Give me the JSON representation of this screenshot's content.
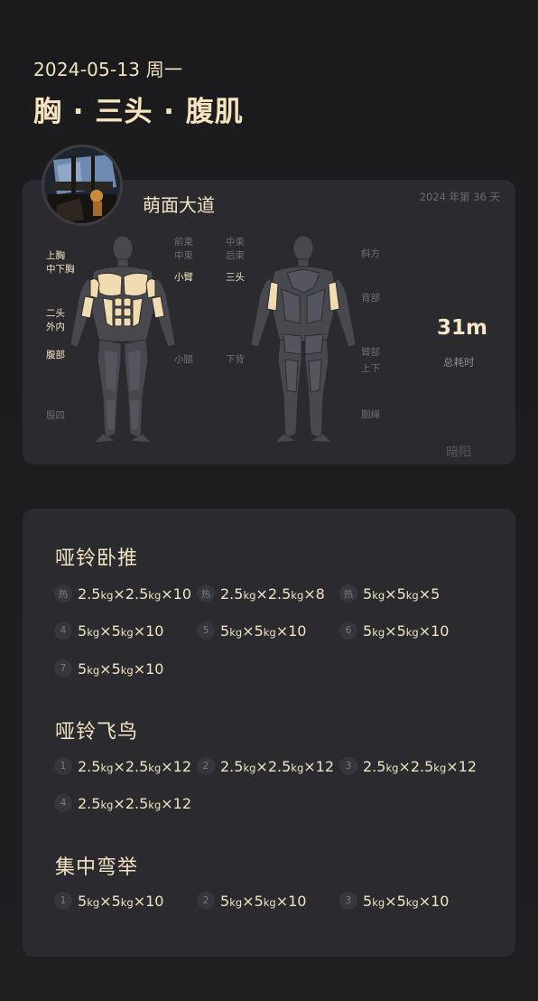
{
  "header": {
    "date": "2024-05-13 周一",
    "title": "胸 · 三头 · 腹肌"
  },
  "profile": {
    "nickname": "萌面大道",
    "day_count": "2024 年第 36 天",
    "author": "暗阳"
  },
  "muscle_labels": {
    "upper_chest": "上胸",
    "mid_lower_chest": "中下胸",
    "biceps": "二头",
    "inner_outer": "外内",
    "abs": "腹部",
    "quads": "股四",
    "front_delt": "前束",
    "mid_delt_front": "中束",
    "forearm": "小臂",
    "calf": "小腿",
    "mid_delt_back": "中束",
    "rear_delt": "后束",
    "triceps": "三头",
    "lower_back": "下背",
    "obliques": "斜方",
    "back": "背部",
    "back_upper_lower_1": "臂部",
    "back_upper_lower_2": "上下",
    "hamstrings": "腘绳"
  },
  "summary": {
    "total_time": "31m",
    "total_label": "总耗时"
  },
  "colors": {
    "accent": "#f1e2c2",
    "muscle_active": "#f0dcb0",
    "muscle_inactive": "#505058"
  },
  "exercises": [
    {
      "name": "哑铃卧推",
      "sets": [
        {
          "badge": "热",
          "w1": "2.5",
          "w2": "2.5",
          "unit": "kg",
          "reps": "10"
        },
        {
          "badge": "热",
          "w1": "2.5",
          "w2": "2.5",
          "unit": "kg",
          "reps": "8"
        },
        {
          "badge": "热",
          "w1": "5",
          "w2": "5",
          "unit": "kg",
          "reps": "5"
        },
        {
          "badge": "4",
          "w1": "5",
          "w2": "5",
          "unit": "kg",
          "reps": "10"
        },
        {
          "badge": "5",
          "w1": "5",
          "w2": "5",
          "unit": "kg",
          "reps": "10"
        },
        {
          "badge": "6",
          "w1": "5",
          "w2": "5",
          "unit": "kg",
          "reps": "10"
        },
        {
          "badge": "7",
          "w1": "5",
          "w2": "5",
          "unit": "kg",
          "reps": "10"
        }
      ]
    },
    {
      "name": "哑铃飞鸟",
      "sets": [
        {
          "badge": "1",
          "w1": "2.5",
          "w2": "2.5",
          "unit": "kg",
          "reps": "12"
        },
        {
          "badge": "2",
          "w1": "2.5",
          "w2": "2.5",
          "unit": "kg",
          "reps": "12"
        },
        {
          "badge": "3",
          "w1": "2.5",
          "w2": "2.5",
          "unit": "kg",
          "reps": "12"
        },
        {
          "badge": "4",
          "w1": "2.5",
          "w2": "2.5",
          "unit": "kg",
          "reps": "12"
        }
      ]
    },
    {
      "name": "集中弯举",
      "sets": [
        {
          "badge": "1",
          "w1": "5",
          "w2": "5",
          "unit": "kg",
          "reps": "10"
        },
        {
          "badge": "2",
          "w1": "5",
          "w2": "5",
          "unit": "kg",
          "reps": "10"
        },
        {
          "badge": "3",
          "w1": "5",
          "w2": "5",
          "unit": "kg",
          "reps": "10"
        }
      ]
    }
  ]
}
